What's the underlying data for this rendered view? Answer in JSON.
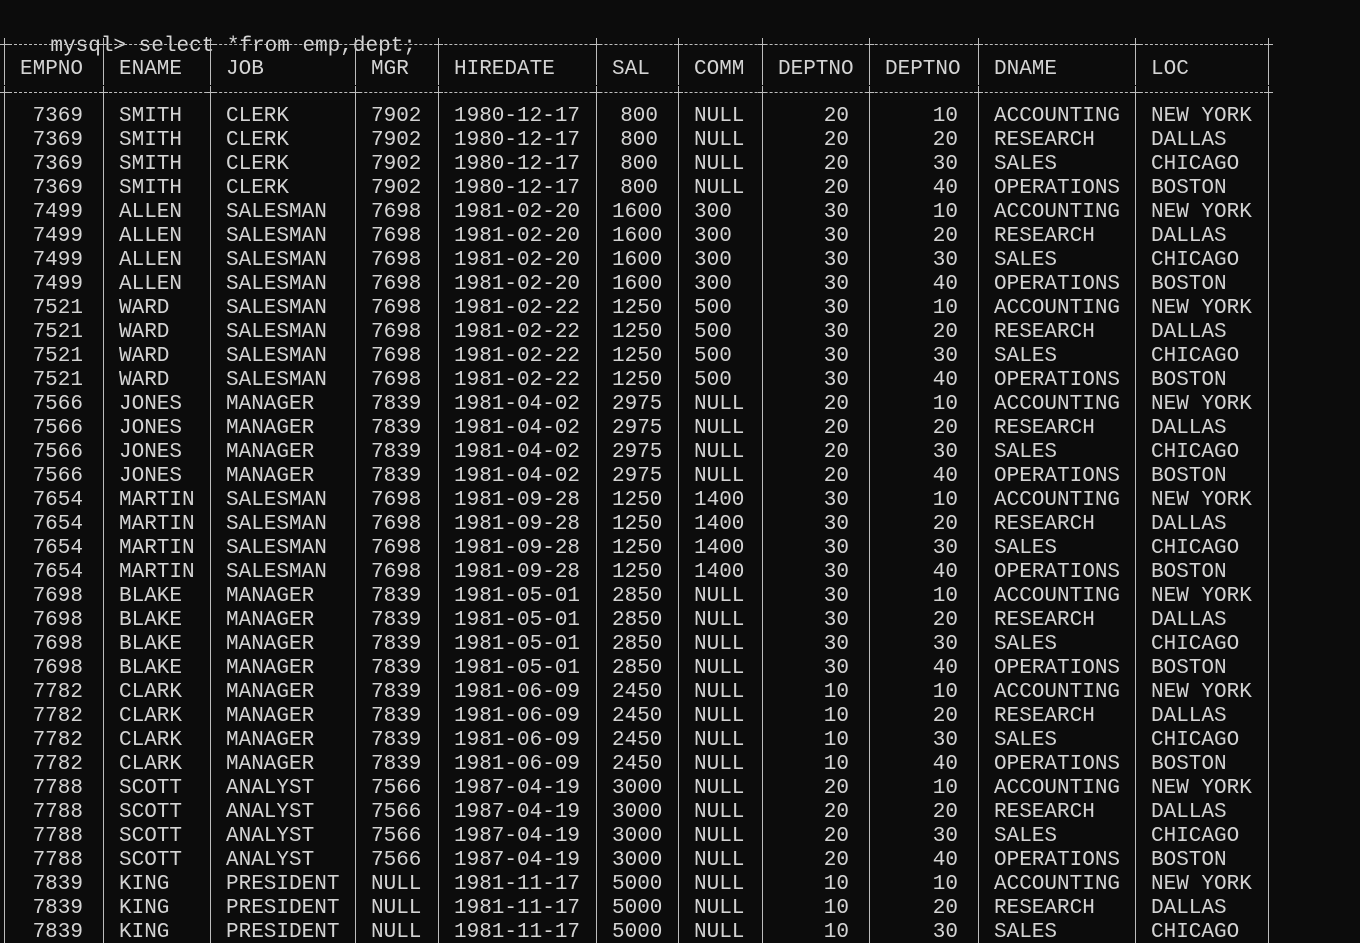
{
  "prompt": "mysql>",
  "command": "select *from emp,dept;",
  "columns": [
    "EMPNO",
    "ENAME",
    "JOB",
    "MGR",
    "HIREDATE",
    "SAL",
    "COMM",
    "DEPTNO",
    "DEPTNO",
    "DNAME",
    "LOC"
  ],
  "rows": [
    [
      "7369",
      "SMITH",
      "CLERK",
      "7902",
      "1980-12-17",
      "800",
      "NULL",
      "20",
      "10",
      "ACCOUNTING",
      "NEW YORK"
    ],
    [
      "7369",
      "SMITH",
      "CLERK",
      "7902",
      "1980-12-17",
      "800",
      "NULL",
      "20",
      "20",
      "RESEARCH",
      "DALLAS"
    ],
    [
      "7369",
      "SMITH",
      "CLERK",
      "7902",
      "1980-12-17",
      "800",
      "NULL",
      "20",
      "30",
      "SALES",
      "CHICAGO"
    ],
    [
      "7369",
      "SMITH",
      "CLERK",
      "7902",
      "1980-12-17",
      "800",
      "NULL",
      "20",
      "40",
      "OPERATIONS",
      "BOSTON"
    ],
    [
      "7499",
      "ALLEN",
      "SALESMAN",
      "7698",
      "1981-02-20",
      "1600",
      "300",
      "30",
      "10",
      "ACCOUNTING",
      "NEW YORK"
    ],
    [
      "7499",
      "ALLEN",
      "SALESMAN",
      "7698",
      "1981-02-20",
      "1600",
      "300",
      "30",
      "20",
      "RESEARCH",
      "DALLAS"
    ],
    [
      "7499",
      "ALLEN",
      "SALESMAN",
      "7698",
      "1981-02-20",
      "1600",
      "300",
      "30",
      "30",
      "SALES",
      "CHICAGO"
    ],
    [
      "7499",
      "ALLEN",
      "SALESMAN",
      "7698",
      "1981-02-20",
      "1600",
      "300",
      "30",
      "40",
      "OPERATIONS",
      "BOSTON"
    ],
    [
      "7521",
      "WARD",
      "SALESMAN",
      "7698",
      "1981-02-22",
      "1250",
      "500",
      "30",
      "10",
      "ACCOUNTING",
      "NEW YORK"
    ],
    [
      "7521",
      "WARD",
      "SALESMAN",
      "7698",
      "1981-02-22",
      "1250",
      "500",
      "30",
      "20",
      "RESEARCH",
      "DALLAS"
    ],
    [
      "7521",
      "WARD",
      "SALESMAN",
      "7698",
      "1981-02-22",
      "1250",
      "500",
      "30",
      "30",
      "SALES",
      "CHICAGO"
    ],
    [
      "7521",
      "WARD",
      "SALESMAN",
      "7698",
      "1981-02-22",
      "1250",
      "500",
      "30",
      "40",
      "OPERATIONS",
      "BOSTON"
    ],
    [
      "7566",
      "JONES",
      "MANAGER",
      "7839",
      "1981-04-02",
      "2975",
      "NULL",
      "20",
      "10",
      "ACCOUNTING",
      "NEW YORK"
    ],
    [
      "7566",
      "JONES",
      "MANAGER",
      "7839",
      "1981-04-02",
      "2975",
      "NULL",
      "20",
      "20",
      "RESEARCH",
      "DALLAS"
    ],
    [
      "7566",
      "JONES",
      "MANAGER",
      "7839",
      "1981-04-02",
      "2975",
      "NULL",
      "20",
      "30",
      "SALES",
      "CHICAGO"
    ],
    [
      "7566",
      "JONES",
      "MANAGER",
      "7839",
      "1981-04-02",
      "2975",
      "NULL",
      "20",
      "40",
      "OPERATIONS",
      "BOSTON"
    ],
    [
      "7654",
      "MARTIN",
      "SALESMAN",
      "7698",
      "1981-09-28",
      "1250",
      "1400",
      "30",
      "10",
      "ACCOUNTING",
      "NEW YORK"
    ],
    [
      "7654",
      "MARTIN",
      "SALESMAN",
      "7698",
      "1981-09-28",
      "1250",
      "1400",
      "30",
      "20",
      "RESEARCH",
      "DALLAS"
    ],
    [
      "7654",
      "MARTIN",
      "SALESMAN",
      "7698",
      "1981-09-28",
      "1250",
      "1400",
      "30",
      "30",
      "SALES",
      "CHICAGO"
    ],
    [
      "7654",
      "MARTIN",
      "SALESMAN",
      "7698",
      "1981-09-28",
      "1250",
      "1400",
      "30",
      "40",
      "OPERATIONS",
      "BOSTON"
    ],
    [
      "7698",
      "BLAKE",
      "MANAGER",
      "7839",
      "1981-05-01",
      "2850",
      "NULL",
      "30",
      "10",
      "ACCOUNTING",
      "NEW YORK"
    ],
    [
      "7698",
      "BLAKE",
      "MANAGER",
      "7839",
      "1981-05-01",
      "2850",
      "NULL",
      "30",
      "20",
      "RESEARCH",
      "DALLAS"
    ],
    [
      "7698",
      "BLAKE",
      "MANAGER",
      "7839",
      "1981-05-01",
      "2850",
      "NULL",
      "30",
      "30",
      "SALES",
      "CHICAGO"
    ],
    [
      "7698",
      "BLAKE",
      "MANAGER",
      "7839",
      "1981-05-01",
      "2850",
      "NULL",
      "30",
      "40",
      "OPERATIONS",
      "BOSTON"
    ],
    [
      "7782",
      "CLARK",
      "MANAGER",
      "7839",
      "1981-06-09",
      "2450",
      "NULL",
      "10",
      "10",
      "ACCOUNTING",
      "NEW YORK"
    ],
    [
      "7782",
      "CLARK",
      "MANAGER",
      "7839",
      "1981-06-09",
      "2450",
      "NULL",
      "10",
      "20",
      "RESEARCH",
      "DALLAS"
    ],
    [
      "7782",
      "CLARK",
      "MANAGER",
      "7839",
      "1981-06-09",
      "2450",
      "NULL",
      "10",
      "30",
      "SALES",
      "CHICAGO"
    ],
    [
      "7782",
      "CLARK",
      "MANAGER",
      "7839",
      "1981-06-09",
      "2450",
      "NULL",
      "10",
      "40",
      "OPERATIONS",
      "BOSTON"
    ],
    [
      "7788",
      "SCOTT",
      "ANALYST",
      "7566",
      "1987-04-19",
      "3000",
      "NULL",
      "20",
      "10",
      "ACCOUNTING",
      "NEW YORK"
    ],
    [
      "7788",
      "SCOTT",
      "ANALYST",
      "7566",
      "1987-04-19",
      "3000",
      "NULL",
      "20",
      "20",
      "RESEARCH",
      "DALLAS"
    ],
    [
      "7788",
      "SCOTT",
      "ANALYST",
      "7566",
      "1987-04-19",
      "3000",
      "NULL",
      "20",
      "30",
      "SALES",
      "CHICAGO"
    ],
    [
      "7788",
      "SCOTT",
      "ANALYST",
      "7566",
      "1987-04-19",
      "3000",
      "NULL",
      "20",
      "40",
      "OPERATIONS",
      "BOSTON"
    ],
    [
      "7839",
      "KING",
      "PRESIDENT",
      "NULL",
      "1981-11-17",
      "5000",
      "NULL",
      "10",
      "10",
      "ACCOUNTING",
      "NEW YORK"
    ],
    [
      "7839",
      "KING",
      "PRESIDENT",
      "NULL",
      "1981-11-17",
      "5000",
      "NULL",
      "10",
      "20",
      "RESEARCH",
      "DALLAS"
    ],
    [
      "7839",
      "KING",
      "PRESIDENT",
      "NULL",
      "1981-11-17",
      "5000",
      "NULL",
      "10",
      "30",
      "SALES",
      "CHICAGO"
    ]
  ]
}
